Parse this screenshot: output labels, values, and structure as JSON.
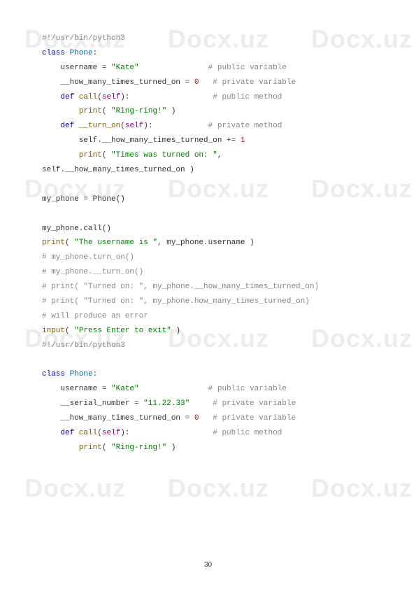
{
  "watermark": "Docx.uz",
  "page_number": "30",
  "code": {
    "l1_com": "#!/usr/bin/python3",
    "l2_kw": "class",
    "l2_cls": " Phone",
    "l2_txt": ":",
    "l3_txt": "    username = ",
    "l3_str": "\"Kate\"",
    "l3_pad": "               ",
    "l3_com": "# public variable",
    "l4_txt1": "    __how_many_times_turned_on = ",
    "l4_num": "0",
    "l4_pad": "   ",
    "l4_com": "# private variable",
    "l5_kw": "def",
    "l5_fn": " call",
    "l5_txt1": "(",
    "l5_self": "self",
    "l5_txt2": "):                  ",
    "l5_com": "# public method",
    "l6_pad": "        ",
    "l6_fn": "print",
    "l6_txt1": "( ",
    "l6_str": "\"Ring-ring!\"",
    "l6_txt2": " )",
    "l7_kw": "def",
    "l7_fn": " __turn_on",
    "l7_txt1": "(",
    "l7_self": "self",
    "l7_txt2": "):            ",
    "l7_com": "# private method",
    "l8_txt1": "        self.__how_many_times_turned_on += ",
    "l8_num": "1",
    "l9_pad": "        ",
    "l9_fn": "print",
    "l9_txt1": "( ",
    "l9_str": "\"Times was turned on: \"",
    "l9_txt2": ", ",
    "l10_txt": "self.__how_many_times_turned_on )",
    "l12_txt": "my_phone = Phone()",
    "l14_txt": "my_phone.call()",
    "l15_fn": "print",
    "l15_txt1": "( ",
    "l15_str": "\"The username is \"",
    "l15_txt2": ", my_phone.username )",
    "l16_com": "# my_phone.turn_on()",
    "l17_com": "# my_phone.__turn_on()",
    "l18_com": "# print( \"Turned on: \", my_phone.__how_many_times_turned_on)",
    "l19_com": "# print( \"Turned on: \", my_phone.how_many_times_turned_on)",
    "l20_com": "# will produce an error",
    "l21_fn": "input",
    "l21_txt1": "( ",
    "l21_str": "\"Press Enter to exit\"",
    "l21_txt2": " )",
    "l22_com": "#!/usr/bin/python3",
    "l24_kw": "class",
    "l24_cls": " Phone",
    "l24_txt": ":",
    "l25_txt": "    username = ",
    "l25_str": "\"Kate\"",
    "l25_pad": "               ",
    "l25_com": "# public variable",
    "l26_txt1": "    __serial_number = ",
    "l26_str": "\"11.22.33\"",
    "l26_pad": "     ",
    "l26_com": "# private variable",
    "l27_txt1": "    __how_many_times_turned_on = ",
    "l27_num": "0",
    "l27_pad": "   ",
    "l27_com": "# private variable",
    "l28_kw": "def",
    "l28_fn": " call",
    "l28_txt1": "(",
    "l28_self": "self",
    "l28_txt2": "):                  ",
    "l28_com": "# public method",
    "l29_pad": "        ",
    "l29_fn": "print",
    "l29_txt1": "( ",
    "l29_str": "\"Ring-ring!\"",
    "l29_txt2": " )"
  }
}
